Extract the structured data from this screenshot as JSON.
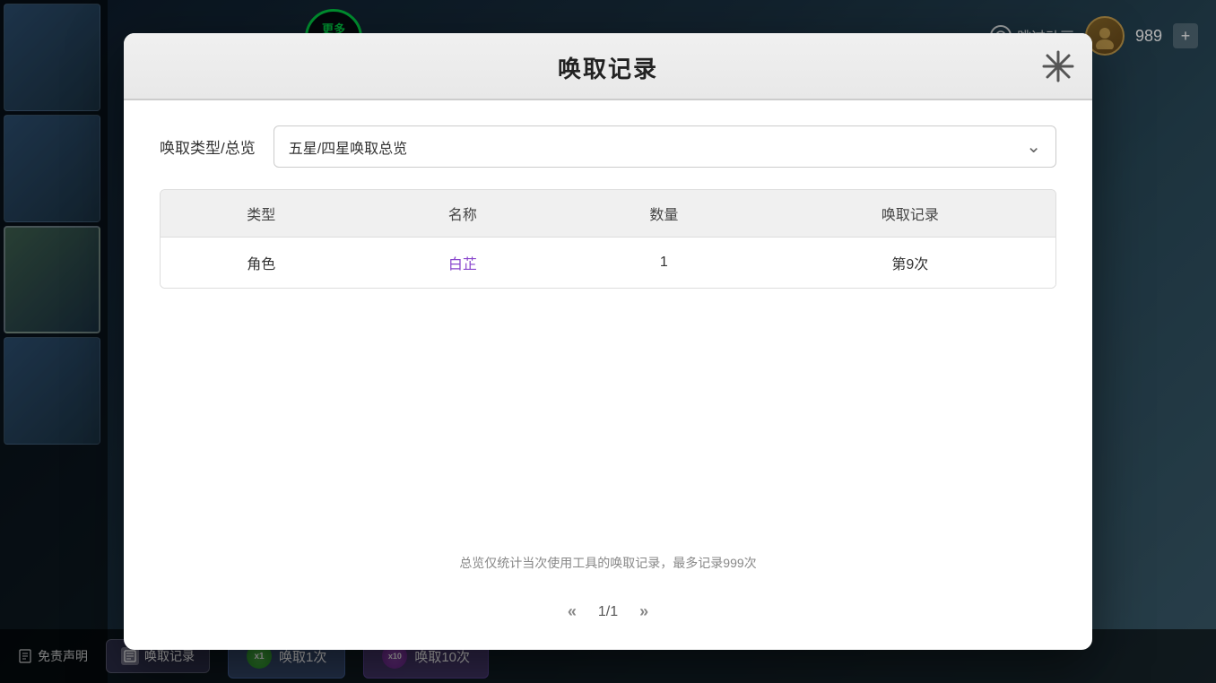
{
  "background": {
    "color": "#1a2a3a"
  },
  "topbar": {
    "skip_label": "跳过动画",
    "currency": "989",
    "add_label": "+"
  },
  "more_tools": {
    "label": "更多\n工具"
  },
  "bottom": {
    "disclaimer_label": "免责声明",
    "history_btn": "唤取记录",
    "summon_x1_label": "唤取1次",
    "summon_x10_label": "唤取10次",
    "x1_cost": "x1",
    "x10_cost": "x10"
  },
  "modal": {
    "title": "唤取记录",
    "close_label": "✕",
    "filter": {
      "label": "唤取类型/总览",
      "selected": "五星/四星唤取总览"
    },
    "table": {
      "columns": [
        "类型",
        "名称",
        "数量",
        "唤取记录"
      ],
      "rows": [
        {
          "type": "角色",
          "name": "白芷",
          "count": "1",
          "record": "第9次"
        }
      ]
    },
    "footer_note": "总览仅统计当次使用工具的唤取记录，最多记录999次",
    "pagination": {
      "prev": "«",
      "next": "»",
      "current": "1/1"
    }
  }
}
